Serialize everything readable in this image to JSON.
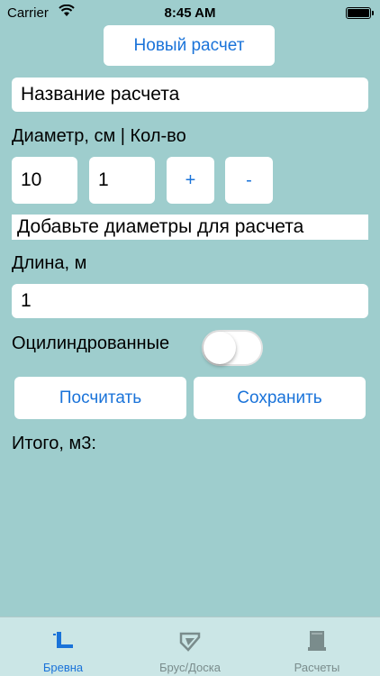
{
  "status_bar": {
    "carrier": "Carrier",
    "time": "8:45 AM"
  },
  "header": {
    "new_calc_label": "Новый расчет"
  },
  "calc_name": {
    "value": "Название расчета"
  },
  "diameter": {
    "label": "Диаметр, см | Кол-во",
    "diameter_value": "10",
    "quantity_value": "1",
    "plus_label": "+",
    "minus_label": "-"
  },
  "diameters_hint": "Добавьте диаметры для расчета",
  "length": {
    "label": "Длина, м",
    "value": "1"
  },
  "cylindered": {
    "label": "Оцилиндрованные",
    "checked": false
  },
  "actions": {
    "calculate_label": "Посчитать",
    "save_label": "Сохранить"
  },
  "total": {
    "label": "Итого, м3:"
  },
  "tabbar": {
    "tabs": [
      {
        "label": "Бревна",
        "icon": "logs-icon",
        "active": true
      },
      {
        "label": "Брус/Доска",
        "icon": "timber-icon",
        "active": false
      },
      {
        "label": "Расчеты",
        "icon": "calculations-icon",
        "active": false
      }
    ]
  },
  "colors": {
    "background": "#9ecdcd",
    "accent": "#1a73d9",
    "tabbar": "#cbe6e6",
    "inactive": "#7a8c8c"
  }
}
